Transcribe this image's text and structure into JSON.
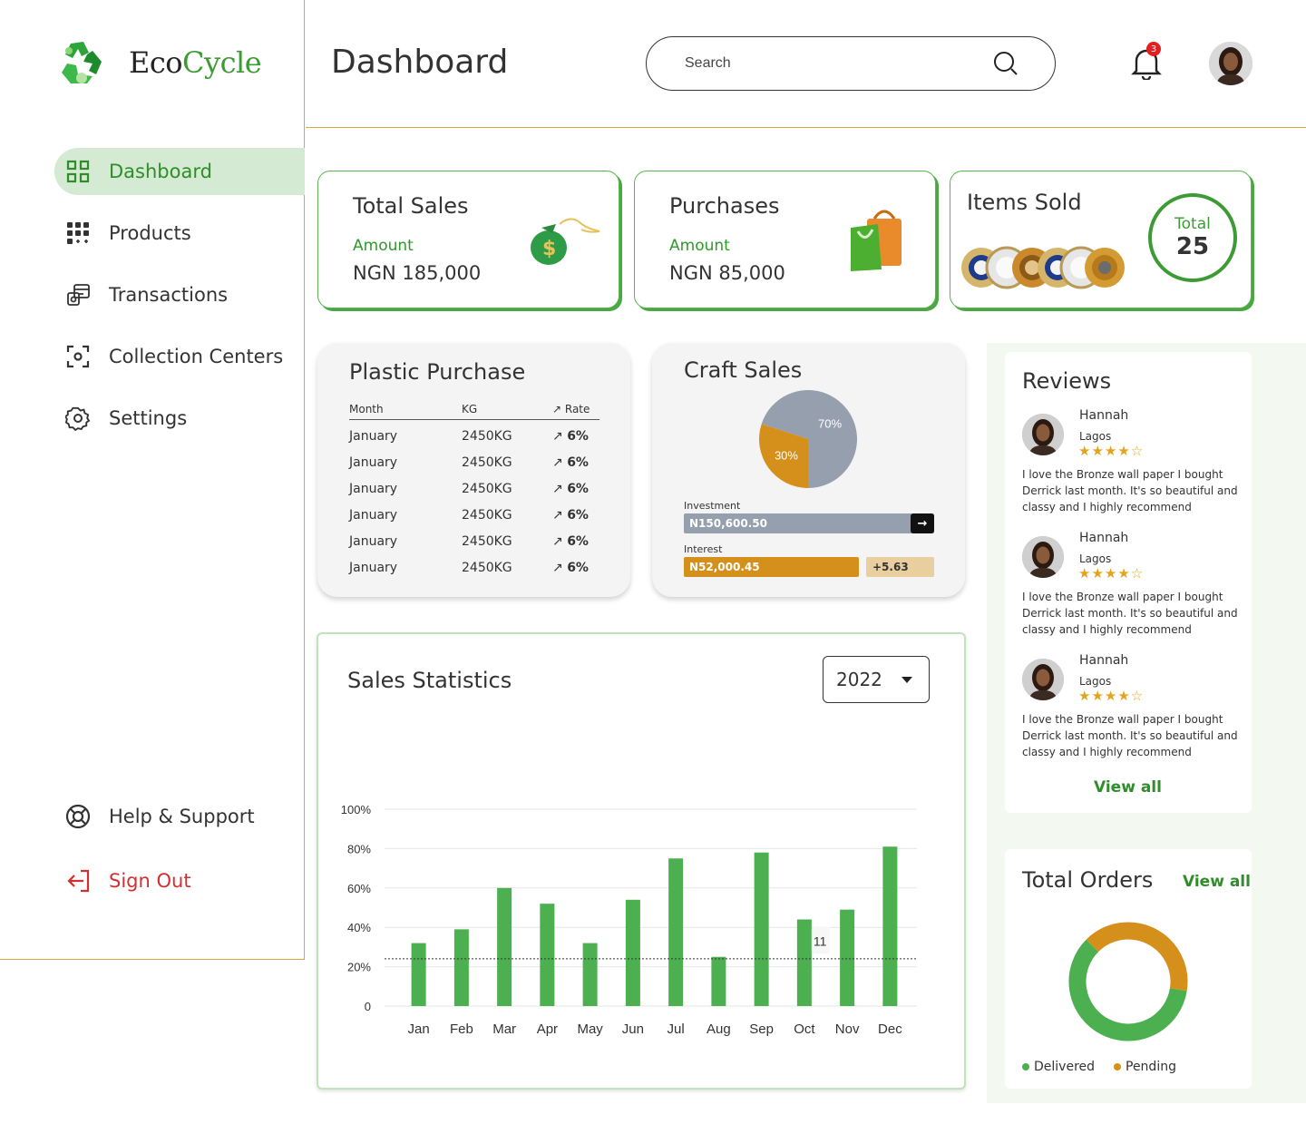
{
  "brand": {
    "name_part1": "Eco",
    "name_part2": "Cycle"
  },
  "sidebar": {
    "items": [
      {
        "label": "Dashboard",
        "icon": "grid-icon",
        "active": true
      },
      {
        "label": "Products",
        "icon": "keypad-icon"
      },
      {
        "label": "Transactions",
        "icon": "transactions-icon"
      },
      {
        "label": "Collection Centers",
        "icon": "scan-icon"
      },
      {
        "label": "Settings",
        "icon": "gear-icon"
      }
    ],
    "help_label": "Help & Support",
    "signout_label": "Sign Out"
  },
  "header": {
    "title": "Dashboard",
    "search_placeholder": "Search",
    "notification_count": "3"
  },
  "cards": {
    "total_sales": {
      "title": "Total Sales",
      "label": "Amount",
      "value": "NGN 185,000"
    },
    "purchases": {
      "title": "Purchases",
      "label": "Amount",
      "value": "NGN 85,000"
    },
    "items_sold": {
      "title": "Items Sold",
      "total_label": "Total",
      "total_value": "25"
    }
  },
  "plastic_purchase": {
    "title": "Plastic Purchase",
    "headers": [
      "Month",
      "KG",
      "Rate"
    ],
    "rows": [
      {
        "month": "January",
        "kg": "2450KG",
        "rate": "6%"
      },
      {
        "month": "January",
        "kg": "2450KG",
        "rate": "6%"
      },
      {
        "month": "January",
        "kg": "2450KG",
        "rate": "6%"
      },
      {
        "month": "January",
        "kg": "2450KG",
        "rate": "6%"
      },
      {
        "month": "January",
        "kg": "2450KG",
        "rate": "6%"
      },
      {
        "month": "January",
        "kg": "2450KG",
        "rate": "6%"
      }
    ]
  },
  "craft_sales": {
    "title": "Craft Sales",
    "investment_label": "Investment",
    "investment_value": "N150,600.50",
    "interest_label": "Interest",
    "interest_value": "N52,000.45",
    "interest_change": "+5.63"
  },
  "sales_statistics": {
    "title": "Sales Statistics",
    "year": "2022",
    "tooltip_value": "11"
  },
  "reviews": {
    "title": "Reviews",
    "items": [
      {
        "name": "Hannah",
        "location": "Lagos",
        "stars": "★★★★☆",
        "text": "I love the Bronze wall paper I bought Derrick last month. It's so beautiful and classy and I highly recommend"
      },
      {
        "name": "Hannah",
        "location": "Lagos",
        "stars": "★★★★☆",
        "text": "I love the Bronze wall paper I bought Derrick last month. It's so beautiful and classy and I highly recommend"
      },
      {
        "name": "Hannah",
        "location": "Lagos",
        "stars": "★★★★☆",
        "text": "I love the Bronze wall paper I bought Derrick last month. It's so beautiful and classy and I highly recommend"
      }
    ],
    "view_all": "View all"
  },
  "total_orders": {
    "title": "Total Orders",
    "view_all": "View all",
    "legend": [
      {
        "label": "Delivered",
        "color": "#4caf50"
      },
      {
        "label": "Pending",
        "color": "#d4901a"
      }
    ]
  },
  "chart_data": [
    {
      "type": "bar",
      "categories": [
        "Jan",
        "Feb",
        "Mar",
        "Apr",
        "May",
        "Jun",
        "Jul",
        "Aug",
        "Sep",
        "Oct",
        "Nov",
        "Dec"
      ],
      "values": [
        32,
        39,
        60,
        52,
        32,
        54,
        75,
        25,
        78,
        44,
        49,
        81
      ],
      "yticks": [
        "0",
        "20%",
        "40%",
        "60%",
        "80%",
        "100%"
      ],
      "ylim": [
        0,
        100
      ],
      "reference_line": 24,
      "color": "#4caf50"
    },
    {
      "type": "pie",
      "labels": [
        "70%",
        "30%"
      ],
      "values": [
        70,
        30
      ],
      "colors": [
        "#969fae",
        "#d4901a"
      ]
    },
    {
      "type": "pie",
      "labels": [
        "Delivered",
        "Pending"
      ],
      "values": [
        60,
        40
      ],
      "colors": [
        "#4caf50",
        "#d4901a"
      ]
    }
  ]
}
